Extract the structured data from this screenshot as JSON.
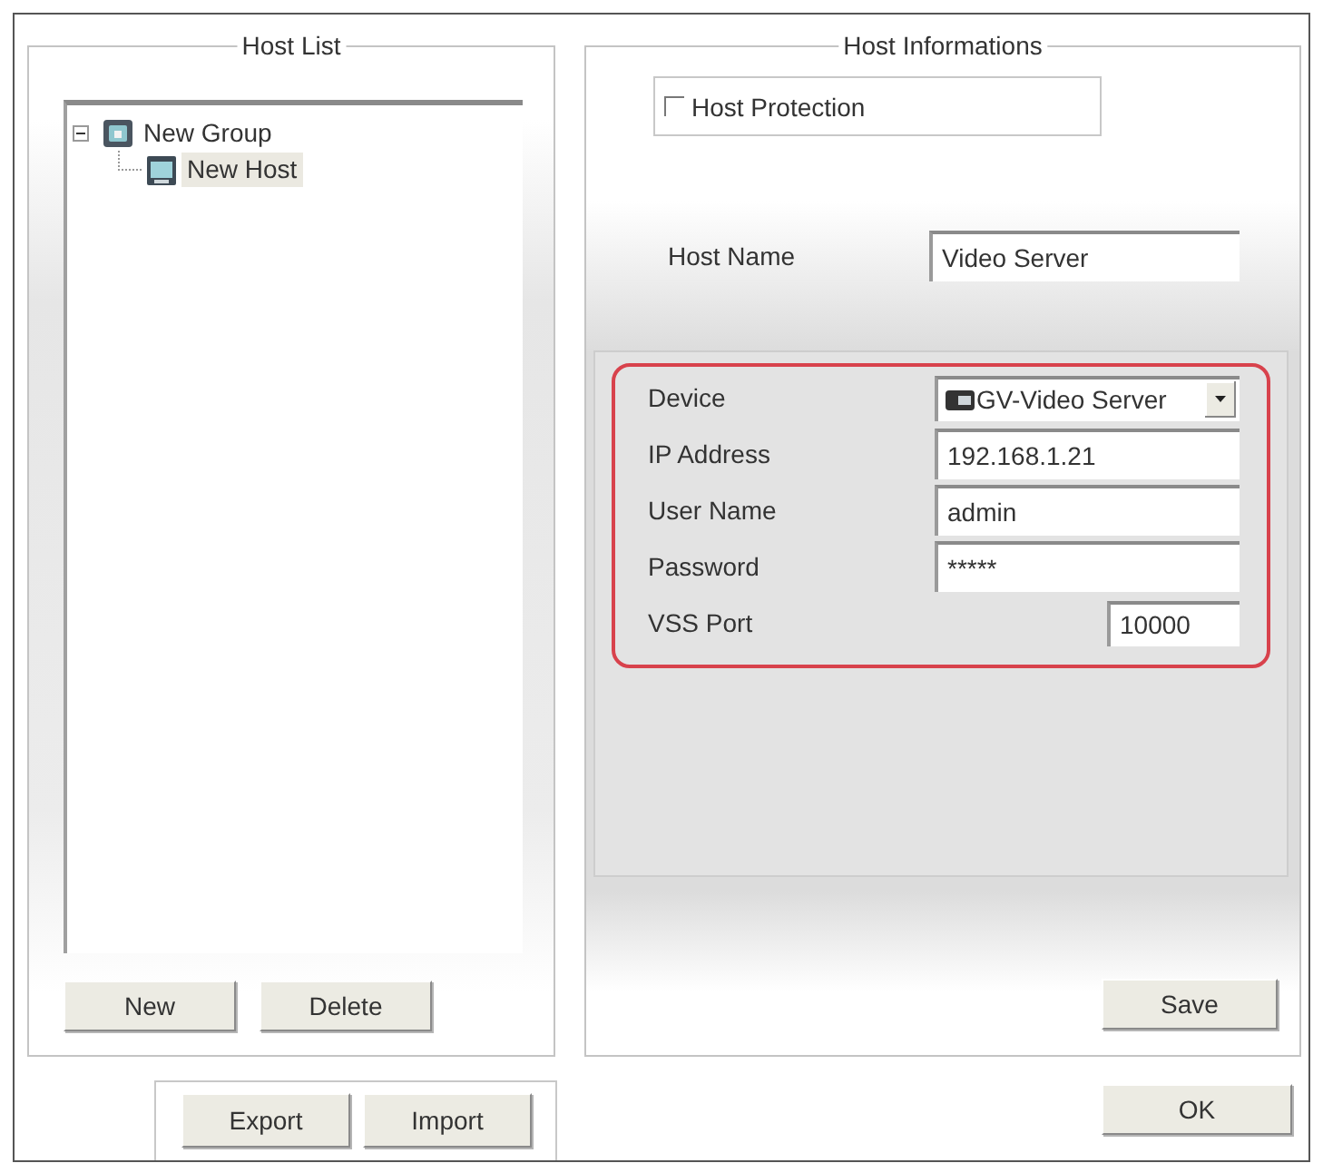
{
  "host_list": {
    "title": "Host List",
    "tree": [
      {
        "label": "New Group",
        "expanded": true,
        "selected": false,
        "children": [
          {
            "label": "New Host",
            "selected": true
          }
        ]
      }
    ],
    "new_button": "New",
    "delete_button": "Delete"
  },
  "host_informations": {
    "title": "Host Informations",
    "host_protection": {
      "label": "Host Protection",
      "checked": false
    },
    "host_name": {
      "label": "Host Name",
      "value": "Video Server"
    },
    "fields": [
      {
        "kind": "dropdown",
        "label": "Device",
        "value": "GV-Video Server"
      },
      {
        "kind": "text",
        "label": "IP Address",
        "value": "192.168.1.21"
      },
      {
        "kind": "text",
        "label": "User Name",
        "value": "admin"
      },
      {
        "kind": "text",
        "label": "Password",
        "value": "*****"
      },
      {
        "kind": "short",
        "label": "VSS Port",
        "value": "10000"
      }
    ],
    "save_button": "Save"
  },
  "export_button": "Export",
  "import_button": "Import",
  "ok_button": "OK"
}
